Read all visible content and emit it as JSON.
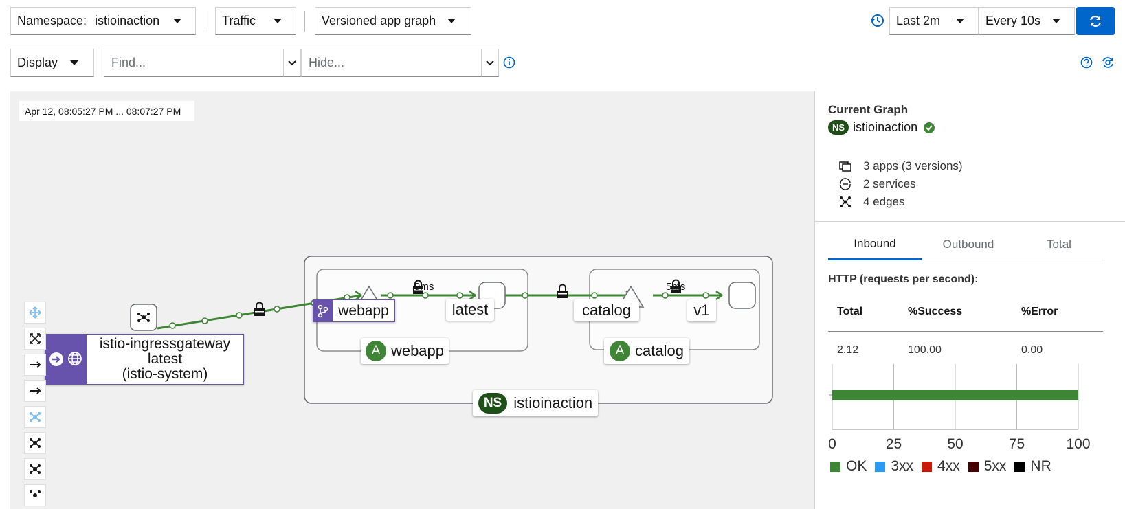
{
  "toolbar": {
    "namespace_label": "Namespace:",
    "namespace_value": "istioinaction",
    "traffic_label": "Traffic",
    "graph_type": "Versioned app graph",
    "time_range": "Last 2m",
    "refresh_interval": "Every 10s",
    "display_label": "Display",
    "find_placeholder": "Find...",
    "hide_placeholder": "Hide..."
  },
  "graph": {
    "timestamp": "Apr 12, 08:05:27 PM ... 08:07:27 PM",
    "nodes": {
      "gateway_name": "istio-ingressgateway",
      "gateway_version": "latest",
      "gateway_namespace": "(istio-system)",
      "webapp_service": "webapp",
      "webapp_version": "latest",
      "webapp_app": "webapp",
      "catalog_service": "catalog",
      "catalog_version": "v1",
      "catalog_app": "catalog",
      "namespace_badge": "NS",
      "app_badge": "A",
      "namespace": "istioinaction"
    },
    "edges": {
      "webapp_latency": "9ms",
      "catalog_latency": "5ms"
    }
  },
  "side": {
    "title": "Current Graph",
    "ns_badge": "NS",
    "namespace": "istioinaction",
    "apps": "3 apps (3 versions)",
    "services": "2 services",
    "edges": "4 edges",
    "tabs": [
      "Inbound",
      "Outbound",
      "Total"
    ],
    "http_heading": "HTTP (requests per second):",
    "table_headers": [
      "Total",
      "%Success",
      "%Error"
    ],
    "table_values": [
      "2.12",
      "100.00",
      "0.00"
    ],
    "axis_ticks": [
      "0",
      "25",
      "50",
      "75",
      "100"
    ],
    "legend": [
      {
        "label": "OK",
        "color": "#3e8635"
      },
      {
        "label": "3xx",
        "color": "#2b9af3"
      },
      {
        "label": "4xx",
        "color": "#c9190b"
      },
      {
        "label": "5xx",
        "color": "#470000"
      },
      {
        "label": "NR",
        "color": "#000000"
      }
    ]
  },
  "chart_data": {
    "type": "bar",
    "categories": [
      ""
    ],
    "series": [
      {
        "name": "OK",
        "values": [
          100
        ]
      },
      {
        "name": "3xx",
        "values": [
          0
        ]
      },
      {
        "name": "4xx",
        "values": [
          0
        ]
      },
      {
        "name": "5xx",
        "values": [
          0
        ]
      },
      {
        "name": "NR",
        "values": [
          0
        ]
      }
    ],
    "xlim": [
      0,
      100
    ],
    "orientation": "horizontal",
    "stacked": true
  }
}
